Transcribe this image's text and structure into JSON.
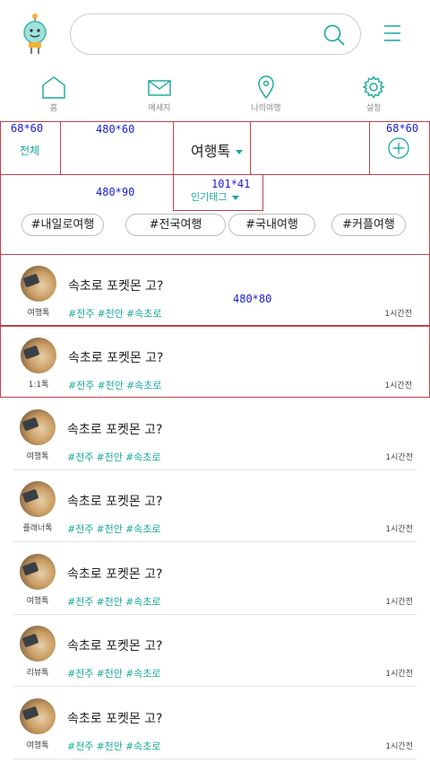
{
  "search": {
    "value": "",
    "placeholder": ""
  },
  "nav": [
    {
      "label": "홈",
      "icon": "home-icon"
    },
    {
      "label": "메세지",
      "icon": "mail-icon"
    },
    {
      "label": "나의여행",
      "icon": "location-pin-icon"
    },
    {
      "label": "설정",
      "icon": "gear-icon"
    }
  ],
  "board_bar": {
    "all_label": "전체",
    "board_title": "여행톡",
    "popular_tag_label": "인기태그"
  },
  "annotations": {
    "all_size": "68*60",
    "bar_size": "480*60",
    "plus_size": "68*60",
    "tag_zone_size": "480*90",
    "poptag_size": "101*41",
    "post_size": "480*80"
  },
  "chips": [
    "#내일로여행",
    "#전국여행",
    "#국내여행",
    "#커플여행"
  ],
  "posts": [
    {
      "board": "여행톡",
      "title": "속초로 포켓몬 고?",
      "tags": [
        "#전주",
        "#천안",
        "#속초로"
      ],
      "time": "1시간전"
    },
    {
      "board": "1:1톡",
      "title": "속초로 포켓몬 고?",
      "tags": [
        "#전주",
        "#천안",
        "#속초로"
      ],
      "time": "1시간전"
    },
    {
      "board": "여행톡",
      "title": "속초로 포켓몬 고?",
      "tags": [
        "#전주",
        "#천안",
        "#속초로"
      ],
      "time": "1시간전"
    },
    {
      "board": "플래너톡",
      "title": "속초로 포켓몬 고?",
      "tags": [
        "#전주",
        "#천안",
        "#속초로"
      ],
      "time": "1시간전"
    },
    {
      "board": "여행톡",
      "title": "속초로 포켓몬 고?",
      "tags": [
        "#전주",
        "#천안",
        "#속초로"
      ],
      "time": "1시간전"
    },
    {
      "board": "리뷰톡",
      "title": "속초로 포켓몬 고?",
      "tags": [
        "#전주",
        "#천안",
        "#속초로"
      ],
      "time": "1시간전"
    },
    {
      "board": "여행톡",
      "title": "속초로 포켓몬 고?",
      "tags": [
        "#전주",
        "#천안",
        "#속초로"
      ],
      "time": "1시간전"
    }
  ],
  "colors": {
    "accent": "#17a89a",
    "annotation_red": "#c0434a",
    "annotation_blue": "#1a1ad6"
  }
}
